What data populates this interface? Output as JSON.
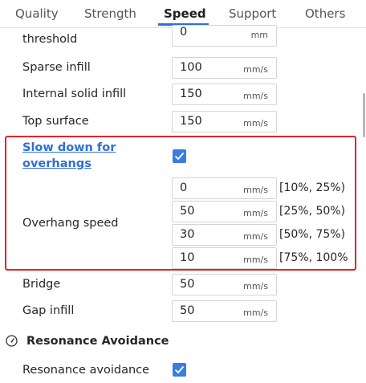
{
  "tabs": [
    {
      "label": "Quality"
    },
    {
      "label": "Strength"
    },
    {
      "label": "Speed"
    },
    {
      "label": "Support"
    },
    {
      "label": "Others"
    }
  ],
  "active_tab": "Speed",
  "rows": {
    "threshold": {
      "label": "threshold",
      "value": "0",
      "unit": "mm"
    },
    "sparse_infill": {
      "label": "Sparse infill",
      "value": "100",
      "unit": "mm/s"
    },
    "internal_solid_infill": {
      "label": "Internal solid infill",
      "value": "150",
      "unit": "mm/s"
    },
    "top_surface": {
      "label": "Top surface",
      "value": "150",
      "unit": "mm/s"
    }
  },
  "slow_down": {
    "line1": "Slow down for",
    "line2": "overhangs",
    "checked": true
  },
  "overhang": {
    "label": "Overhang speed",
    "items": [
      {
        "value": "0",
        "unit": "mm/s",
        "range": "[10%, 25%)"
      },
      {
        "value": "50",
        "unit": "mm/s",
        "range": "[25%, 50%)"
      },
      {
        "value": "30",
        "unit": "mm/s",
        "range": "[50%, 75%)"
      },
      {
        "value": "10",
        "unit": "mm/s",
        "range": "[75%, 100%"
      }
    ]
  },
  "rows2": {
    "bridge": {
      "label": "Bridge",
      "value": "50",
      "unit": "mm/s"
    },
    "gap_infill": {
      "label": "Gap infill",
      "value": "50",
      "unit": "mm/s"
    }
  },
  "resonance": {
    "section_title": "Resonance Avoidance",
    "label": "Resonance avoidance",
    "checked": true
  },
  "colors": {
    "accent": "#3b7de0",
    "highlight": "#e0252b",
    "link": "#2f6fd6"
  }
}
